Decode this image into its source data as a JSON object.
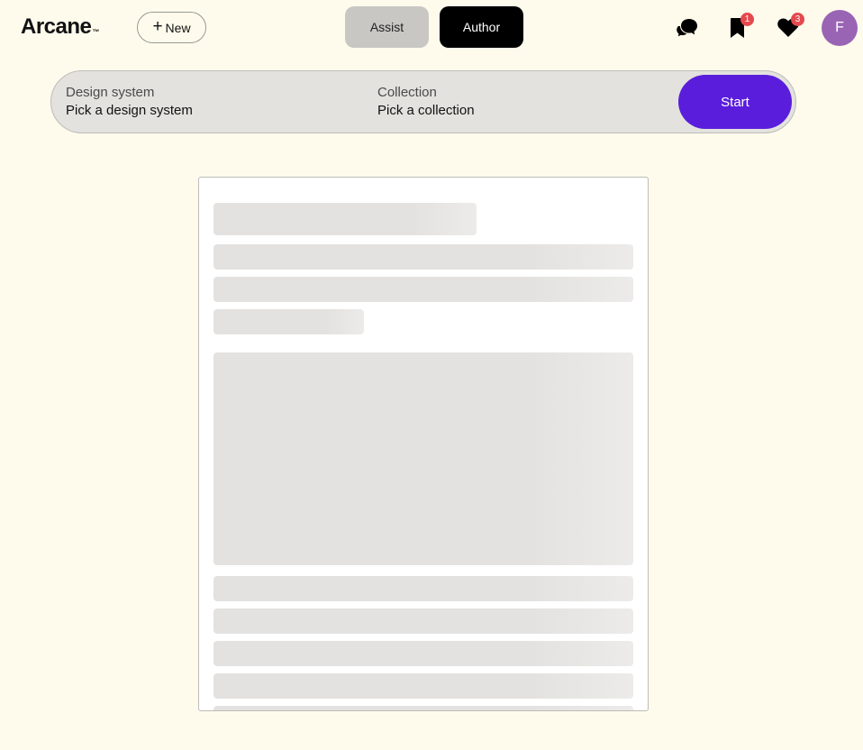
{
  "header": {
    "logo_text": "Arcane",
    "logo_tm": "™",
    "new_button": {
      "icon": "plus-icon",
      "label": "New"
    },
    "tabs": [
      {
        "label": "Assist",
        "active": false
      },
      {
        "label": "Author",
        "active": true
      }
    ],
    "icons": {
      "chat": {
        "icon": "chat-bubbles-icon"
      },
      "bookmarks": {
        "icon": "bookmark-icon",
        "badge": "1"
      },
      "likes": {
        "icon": "heart-icon",
        "badge": "3"
      }
    },
    "avatar_initial": "F"
  },
  "picker": {
    "design_system": {
      "label": "Design system",
      "value": "Pick a design system"
    },
    "collection": {
      "label": "Collection",
      "value": "Pick a collection"
    },
    "start_label": "Start"
  },
  "colors": {
    "background": "#fefbec",
    "accent": "#5a1ddb",
    "badge": "#e5484d",
    "avatar": "#9a64b4",
    "skeleton": "#e3e2e0"
  }
}
